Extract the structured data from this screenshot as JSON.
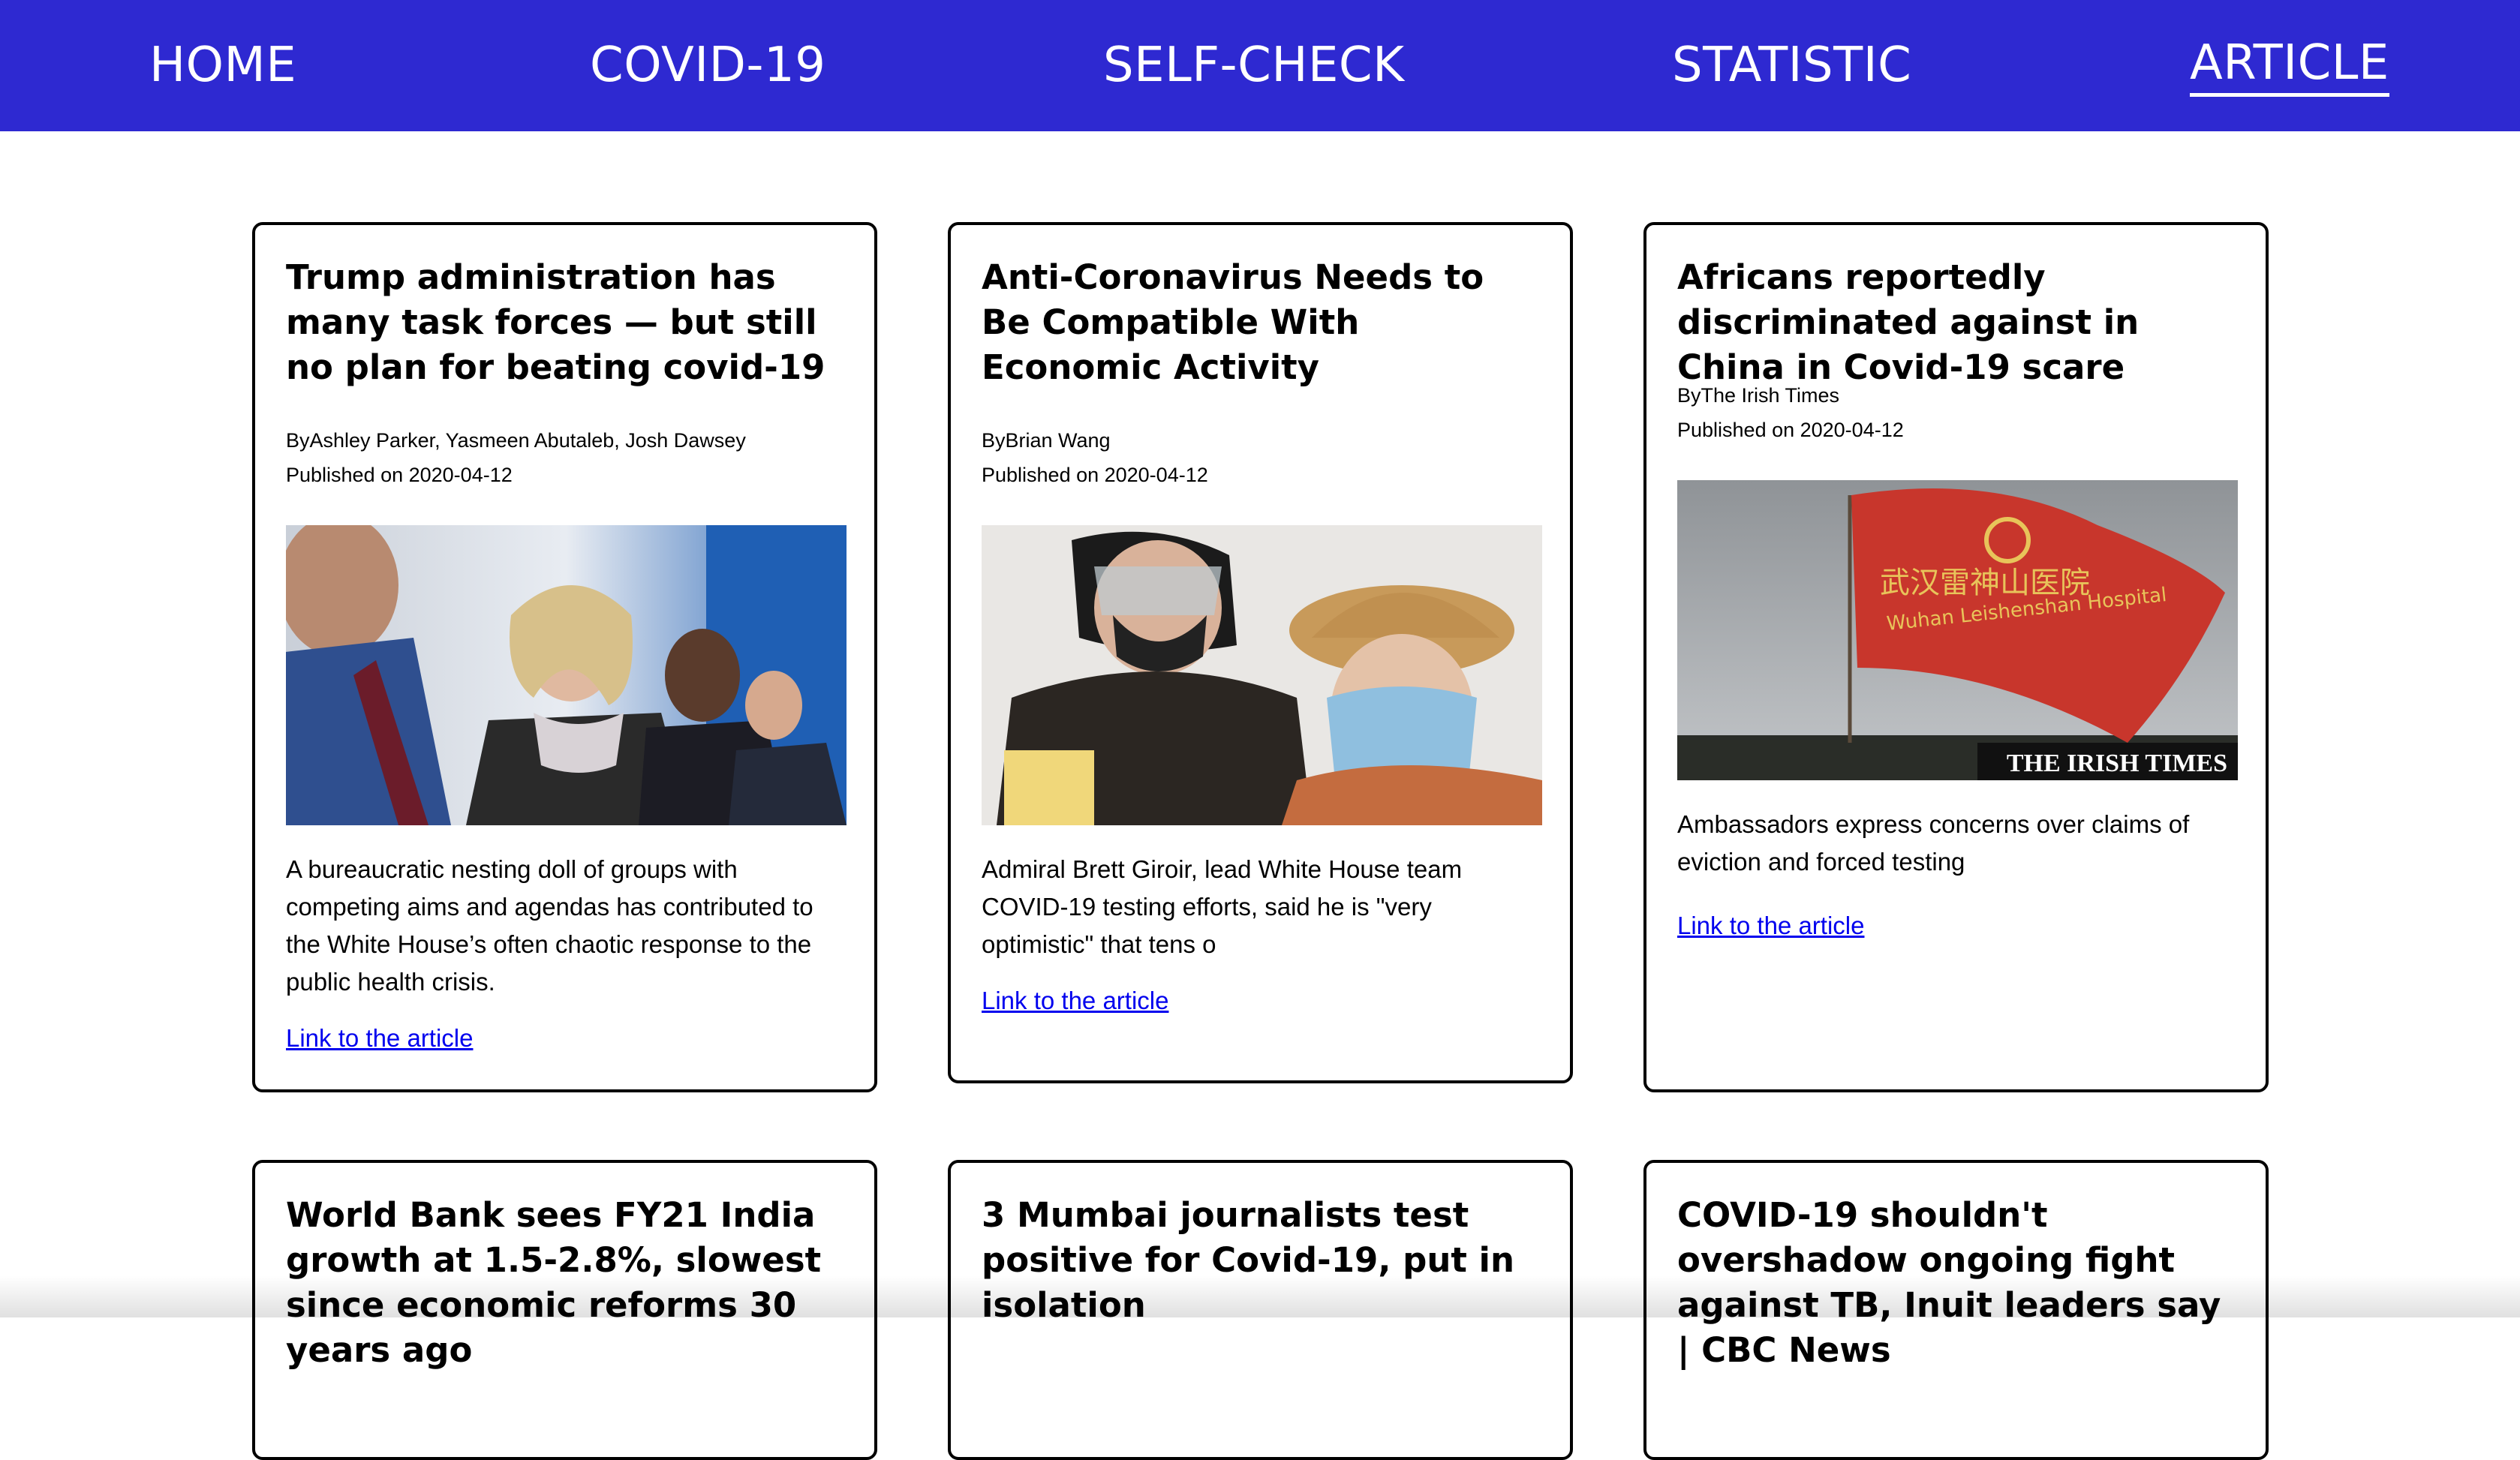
{
  "nav": {
    "items": [
      {
        "label": "HOME",
        "active": false
      },
      {
        "label": "COVID-19",
        "active": false
      },
      {
        "label": "SELF-CHECK",
        "active": false
      },
      {
        "label": "STATISTIC",
        "active": false
      },
      {
        "label": "ARTICLE",
        "active": true
      }
    ]
  },
  "colors": {
    "nav_bg": "#2e29d1",
    "link": "#0000ee"
  },
  "articles": [
    {
      "title": "Trump administration has many task forces — but still no plan for beating covid-19",
      "byline": "ByAshley Parker, Yasmeen Abutaleb, Josh Dawsey",
      "published": "Published on 2020-04-12",
      "image": "photo-officials-seated",
      "description": "A bureaucratic nesting doll of groups with competing aims and agendas has contributed to the White House’s often chaotic response to the public health crisis.",
      "link_label": "Link to the article"
    },
    {
      "title": "Anti-Coronavirus Needs to Be Compatible With Economic Activity",
      "byline": "ByBrian Wang",
      "published": "Published on 2020-04-12",
      "image": "photo-masked-people",
      "description": "Admiral Brett Giroir, lead White House team COVID-19 testing efforts, said he is \"very optimistic\" that tens o",
      "link_label": "Link to the article"
    },
    {
      "title": "Africans reportedly discriminated against in China in Covid-19 scare",
      "byline": "ByThe Irish Times",
      "published": "Published on 2020-04-12",
      "image": "photo-red-flag",
      "image_text": {
        "flag_chinese": "武汉雷神山医院",
        "flag_english": "Wuhan Leishenshan Hospital",
        "watermark": "THE IRISH TIMES"
      },
      "description": "Ambassadors express concerns over claims of eviction and forced testing",
      "link_label": "Link to the article"
    },
    {
      "title": "World Bank sees FY21 India growth at 1.5-2.8%, slowest since economic reforms 30 years ago"
    },
    {
      "title": "3 Mumbai journalists test positive for Covid-19, put in isolation"
    },
    {
      "title": "COVID-19 shouldn't overshadow ongoing fight against TB, Inuit leaders say | CBC News"
    }
  ]
}
